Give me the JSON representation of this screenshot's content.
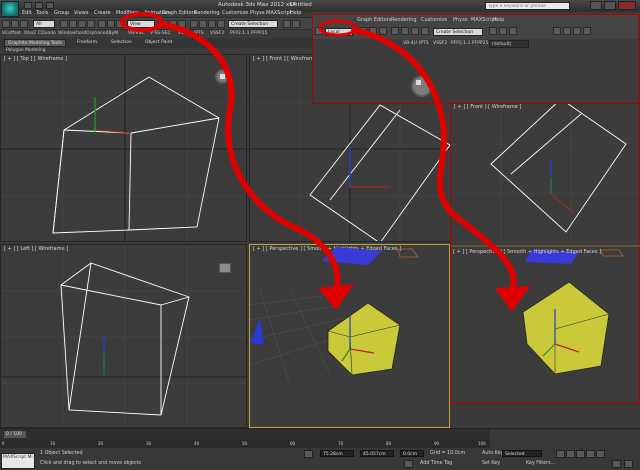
{
  "app": {
    "title": "Autodesk 3ds Max 2012 x64",
    "doc_title": "Untitled",
    "search_placeholder": "Type a keyword or phrase"
  },
  "menu": [
    "Edit",
    "Tools",
    "Group",
    "Views",
    "Create",
    "Modifiers",
    "Animation",
    "Graph Editors",
    "Rendering",
    "Customize",
    "Physx",
    "MAXScript",
    "Help"
  ],
  "toolbar": {
    "filter": "All",
    "coord_system": "View",
    "coord_system_overlay": "Local",
    "selection_set": "Create Selection",
    "default_layer": "(default)"
  },
  "ribbon": {
    "items": [
      "VCoffset",
      "Ohe2",
      "CDundo",
      "Window",
      "fundOrphanedByM",
      "VB-VSC",
      "V-SS-SEC",
      "VB-4U",
      "IPTS",
      "VSSF2",
      "PFP2.1.1 PFPP25"
    ],
    "overlay_items": [
      "VB-4U",
      "IPTS",
      "VSSF2",
      "PFP2.1.1 PFPP25"
    ]
  },
  "tabs": [
    "Graphite Modeling Tools",
    "Freeform",
    "Selection",
    "Object Paint"
  ],
  "subpanel": "Polygon Modeling",
  "viewports": {
    "top": "[ + ] [ Top ] [ Wireframe ]",
    "front": "[ + ] [ Front ] [ Wireframe ]",
    "left": "[ + ] [ Left ] [ Wireframe ]",
    "perspective": "[ + ] [ Perspective ] [ Smooth + Highlights + Edged Faces ]",
    "overlay_front": "[ + ] [ Front ] [ Wireframe ]",
    "overlay_perspective": "[ + ] [ Perspective ] [ Smooth + Highlights + Edged Faces ]"
  },
  "timeline": {
    "range": "0 / 100",
    "ticks": [
      "0",
      "10",
      "20",
      "30",
      "40",
      "50",
      "60",
      "70",
      "80",
      "90",
      "100"
    ]
  },
  "status": {
    "maxscript": "MAXScript Mi",
    "selection": "1 Object Selected",
    "prompt": "Click and drag to select and move objects",
    "x": "75.28cm",
    "y": "45.057cm",
    "z": "0.0cm",
    "grid": "Grid = 10.0cm",
    "add_time_tag": "Add Time Tag",
    "auto_key": "Auto Key",
    "set_key": "Set Key",
    "selected": "Selected",
    "key_filters": "Key Filters..."
  },
  "colors": {
    "annotation_red": "#e00000",
    "cube_yellow": "#c9c93a",
    "viewport_bg": "#3c3c3c",
    "plane_blue": "#3a3ad8"
  }
}
